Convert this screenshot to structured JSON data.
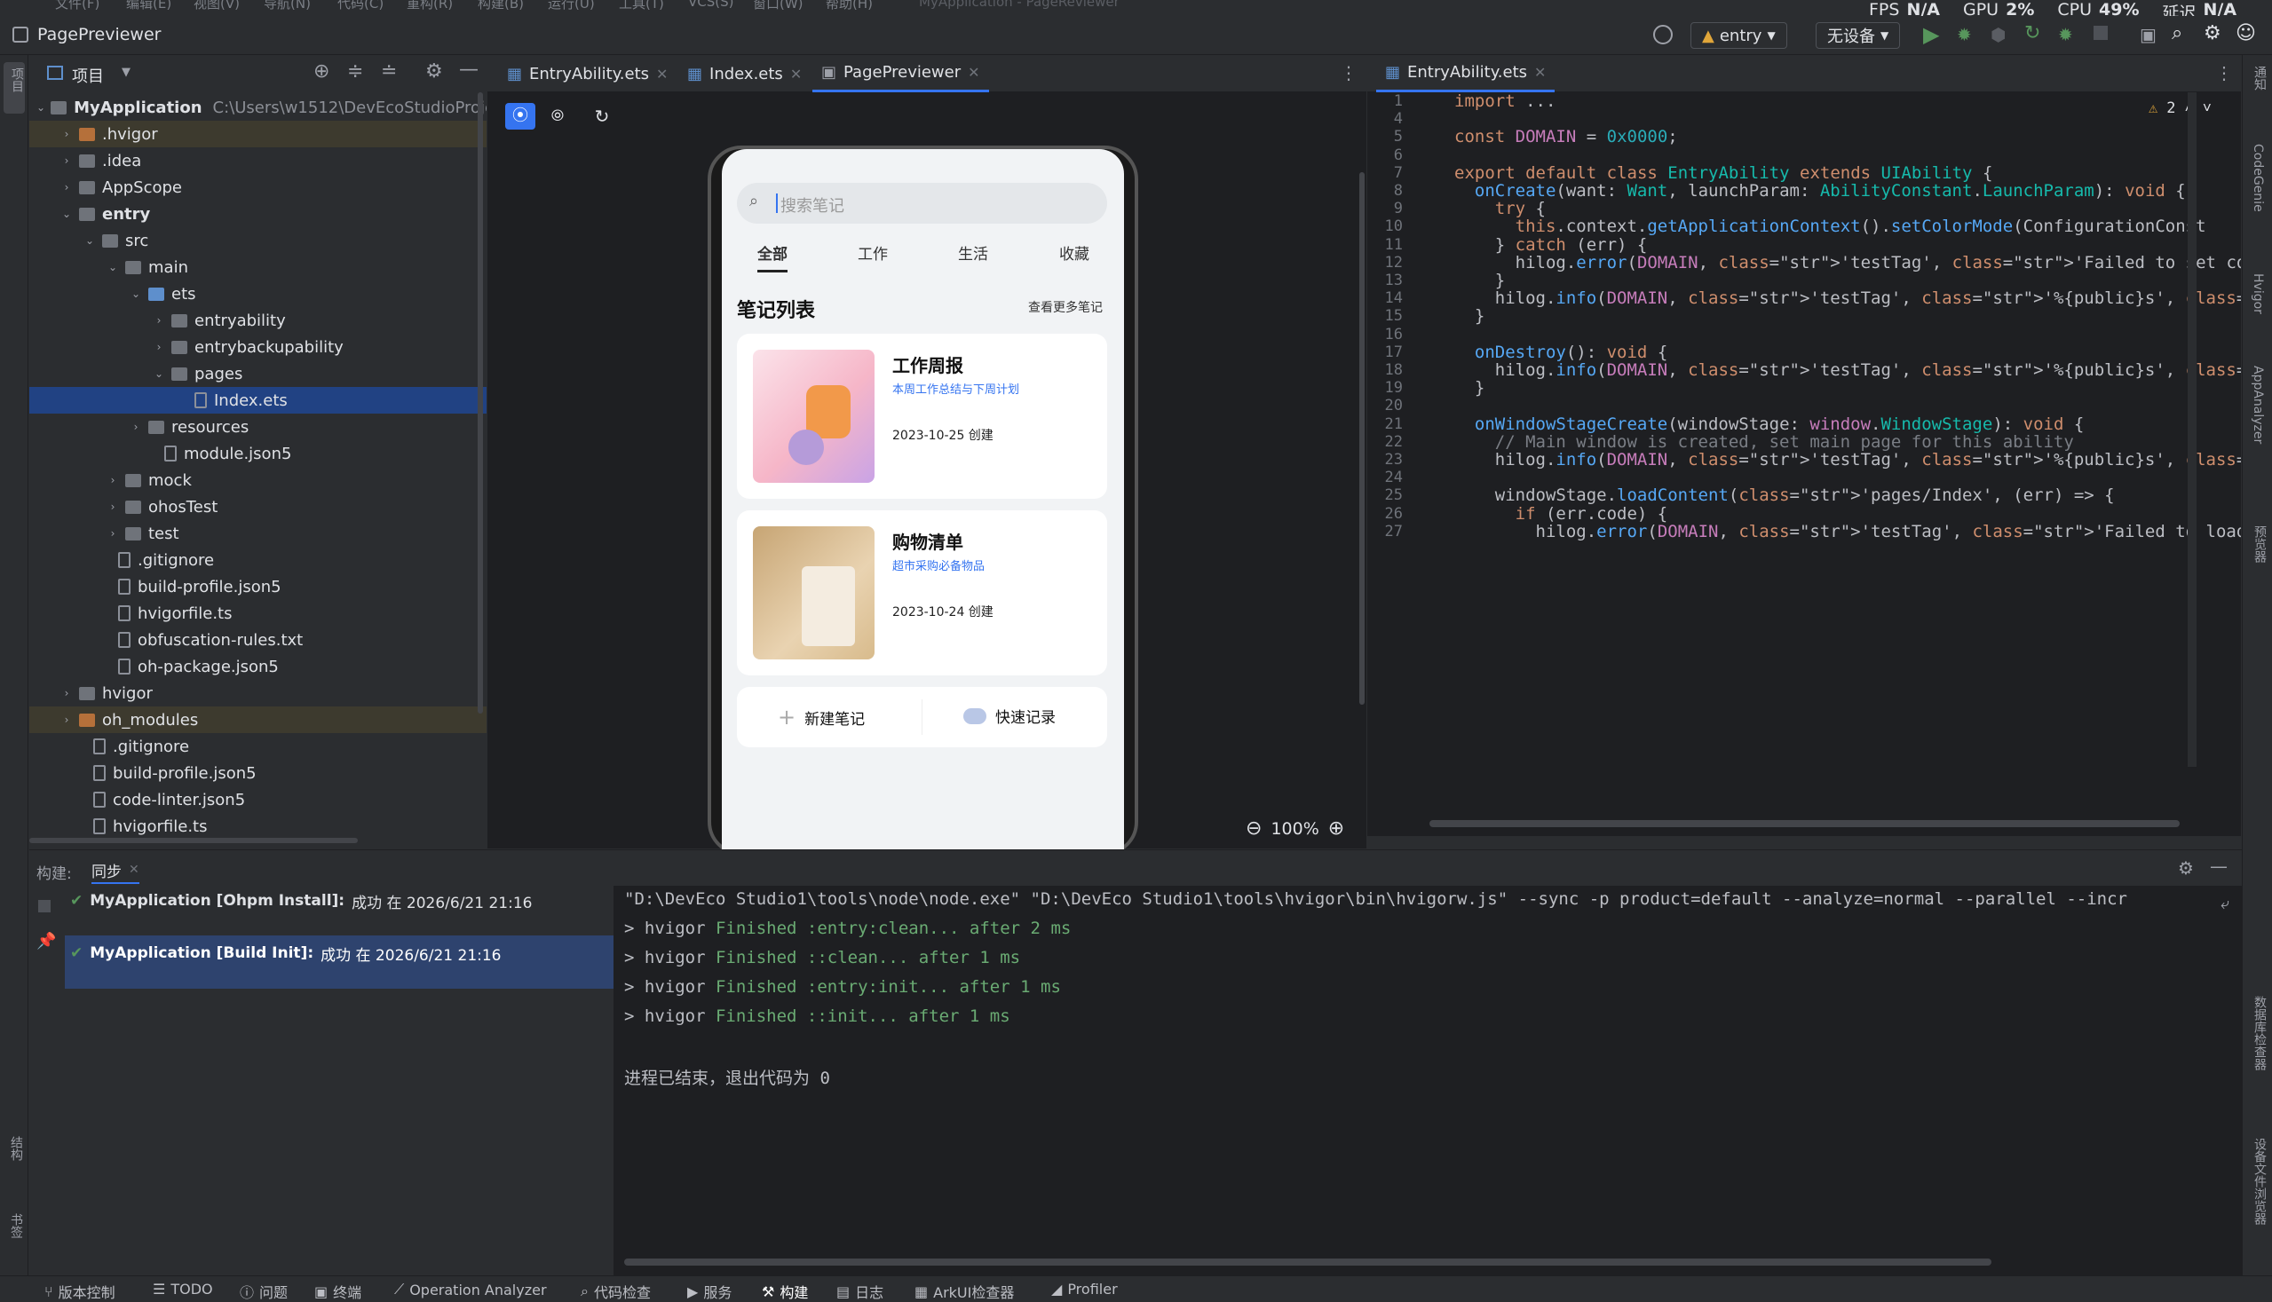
{
  "menubar": {
    "items": [
      "文件(F)",
      "编辑(E)",
      "视图(V)",
      "导航(N)",
      "代码(C)",
      "重构(R)",
      "构建(B)",
      "运行(U)",
      "工具(T)",
      "VCS(S)",
      "窗口(W)",
      "帮助(H)"
    ],
    "window_title": "MyApplication - PageReviewer"
  },
  "stats": {
    "fps_label": "FPS",
    "fps": "N/A",
    "gpu_label": "GPU",
    "gpu": "2%",
    "cpu_label": "CPU",
    "cpu": "49%",
    "latency_label": "延迟",
    "latency": "N/A"
  },
  "titlebar": {
    "title": "PagePreviewer",
    "module": "entry",
    "device": "无设备"
  },
  "project": {
    "panel_label": "项目",
    "root": "MyApplication",
    "root_path": "C:\\Users\\w1512\\DevEcoStudioProjects",
    "tree": [
      ".hvigor",
      ".idea",
      "AppScope",
      "entry",
      "src",
      "main",
      "ets",
      "entryability",
      "entrybackupability",
      "pages",
      "Index.ets",
      "resources",
      "module.json5",
      "mock",
      "ohosTest",
      "test",
      ".gitignore",
      "build-profile.json5",
      "hvigorfile.ts",
      "obfuscation-rules.txt",
      "oh-package.json5",
      "hvigor",
      "oh_modules",
      ".gitignore",
      "build-profile.json5",
      "code-linter.json5",
      "hvigorfile.ts"
    ]
  },
  "editor_tabs": [
    "EntryAbility.ets",
    "Index.ets",
    "PagePreviewer"
  ],
  "code_tab": "EntryAbility.ets",
  "preview": {
    "zoom": "100%",
    "search_placeholder": "搜索笔记",
    "tabs": [
      "全部",
      "工作",
      "生活",
      "收藏"
    ],
    "list_title": "笔记列表",
    "more": "查看更多笔记",
    "notes": [
      {
        "title": "工作周报",
        "subtitle": "本周工作总结与下周计划",
        "date": "2023-10-25 创建"
      },
      {
        "title": "购物清单",
        "subtitle": "超市采购必备物品",
        "date": "2023-10-24 创建"
      }
    ],
    "actions": [
      "新建笔记",
      "快速记录"
    ]
  },
  "warnings": "2",
  "code_lines": [
    {
      "n": "1",
      "t": "import ..."
    },
    {
      "n": "4",
      "t": ""
    },
    {
      "n": "5",
      "t": "const DOMAIN = 0x0000;"
    },
    {
      "n": "6",
      "t": ""
    },
    {
      "n": "7",
      "t": "export default class EntryAbility extends UIAbility {"
    },
    {
      "n": "8",
      "t": "  onCreate(want: Want, launchParam: AbilityConstant.LaunchParam): void {"
    },
    {
      "n": "9",
      "t": "    try {"
    },
    {
      "n": "10",
      "t": "      this.context.getApplicationContext().setColorMode(ConfigurationConst"
    },
    {
      "n": "11",
      "t": "    } catch (err) {"
    },
    {
      "n": "12",
      "t": "      hilog.error(DOMAIN, 'testTag', 'Failed to set colorMode. Cause: %{pu"
    },
    {
      "n": "13",
      "t": "    }"
    },
    {
      "n": "14",
      "t": "    hilog.info(DOMAIN, 'testTag', '%{public}s', 'Ability onCreate');"
    },
    {
      "n": "15",
      "t": "  }"
    },
    {
      "n": "16",
      "t": ""
    },
    {
      "n": "17",
      "t": "  onDestroy(): void {"
    },
    {
      "n": "18",
      "t": "    hilog.info(DOMAIN, 'testTag', '%{public}s', 'Ability onDestroy');"
    },
    {
      "n": "19",
      "t": "  }"
    },
    {
      "n": "20",
      "t": ""
    },
    {
      "n": "21",
      "t": "  onWindowStageCreate(windowStage: window.WindowStage): void {"
    },
    {
      "n": "22",
      "t": "    // Main window is created, set main page for this ability"
    },
    {
      "n": "23",
      "t": "    hilog.info(DOMAIN, 'testTag', '%{public}s', 'Ability onWindowStageCrea"
    },
    {
      "n": "24",
      "t": ""
    },
    {
      "n": "25",
      "t": "    windowStage.loadContent('pages/Index', (err) => {"
    },
    {
      "n": "26",
      "t": "      if (err.code) {"
    },
    {
      "n": "27",
      "t": "        hilog.error(DOMAIN, 'testTag', 'Failed to load the content. Cause:"
    }
  ],
  "bottom": {
    "build_label": "构建:",
    "sync_tab": "同步",
    "builds": [
      {
        "name": "MyApplication [Ohpm Install]:",
        "status": "成功 在 2026/6/21 21:16"
      },
      {
        "name": "MyApplication [Build Init]:",
        "status": "成功 在 2026/6/21 21:16"
      }
    ],
    "console": [
      "\"D:\\DevEco Studio1\\tools\\node\\node.exe\" \"D:\\DevEco Studio1\\tools\\hvigor\\bin\\hvigorw.js\" --sync -p product=default --analyze=normal --parallel --incr",
      "> hvigor Finished :entry:clean... after 2 ms",
      "> hvigor Finished ::clean... after 1 ms",
      "> hvigor Finished :entry:init... after 1 ms",
      "> hvigor Finished ::init... after 1 ms",
      "",
      "进程已结束，退出代码为 0"
    ]
  },
  "left_tools": [
    "项目",
    "结构",
    "书签"
  ],
  "right_tools": [
    "通知",
    "CodeGenie",
    "Hvigor",
    "AppAnalyzer",
    "预览器",
    "数据库检查器",
    "设备文件浏览器"
  ],
  "statusbar": [
    "版本控制",
    "TODO",
    "问题",
    "终端",
    "Operation Analyzer",
    "代码检查",
    "服务",
    "构建",
    "日志",
    "ArkUI检查器",
    "Profiler"
  ]
}
